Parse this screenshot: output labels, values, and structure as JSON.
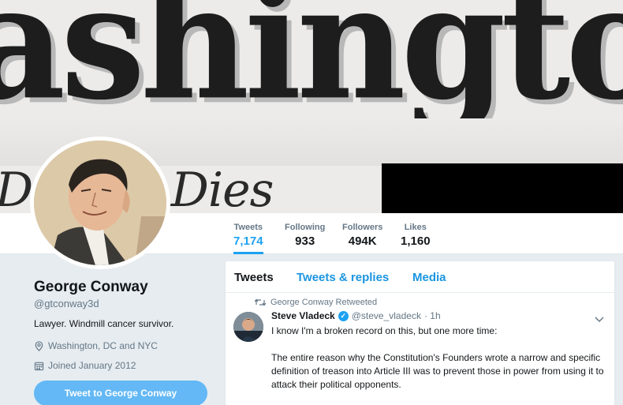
{
  "banner": {
    "headline_fragment": "De   acu Dies"
  },
  "stats": [
    {
      "label": "Tweets",
      "value": "7,174"
    },
    {
      "label": "Following",
      "value": "933"
    },
    {
      "label": "Followers",
      "value": "494K"
    },
    {
      "label": "Likes",
      "value": "1,160"
    }
  ],
  "profile": {
    "name": "George Conway",
    "handle": "@gtconway3d",
    "bio": "Lawyer. Windmill cancer survivor.",
    "location": "Washington, DC and NYC",
    "joined": "Joined January 2012",
    "tweet_to_label": "Tweet to George Conway"
  },
  "timeline": {
    "tabs": [
      "Tweets",
      "Tweets & replies",
      "Media"
    ],
    "tweet": {
      "retweeted_by": "George Conway Retweeted",
      "author_name": "Steve Vladeck",
      "author_handle": "@steve_vladeck",
      "time": "· 1h",
      "paragraphs": [
        "I know I'm a broken record on this, but one more time:",
        "The entire reason why the Constitution's Founders wrote a narrow and specific definition of treason into Article III was to prevent those in power from using it to attack their political opponents."
      ]
    }
  },
  "colors": {
    "accent": "#1da1f2",
    "link": "#1b95e0",
    "muted": "#657786",
    "button": "#63b8f5",
    "background": "#e6ecf0"
  },
  "icons": [
    "location-icon",
    "calendar-icon",
    "retweet-icon",
    "verified-icon",
    "chevron-down-icon"
  ]
}
